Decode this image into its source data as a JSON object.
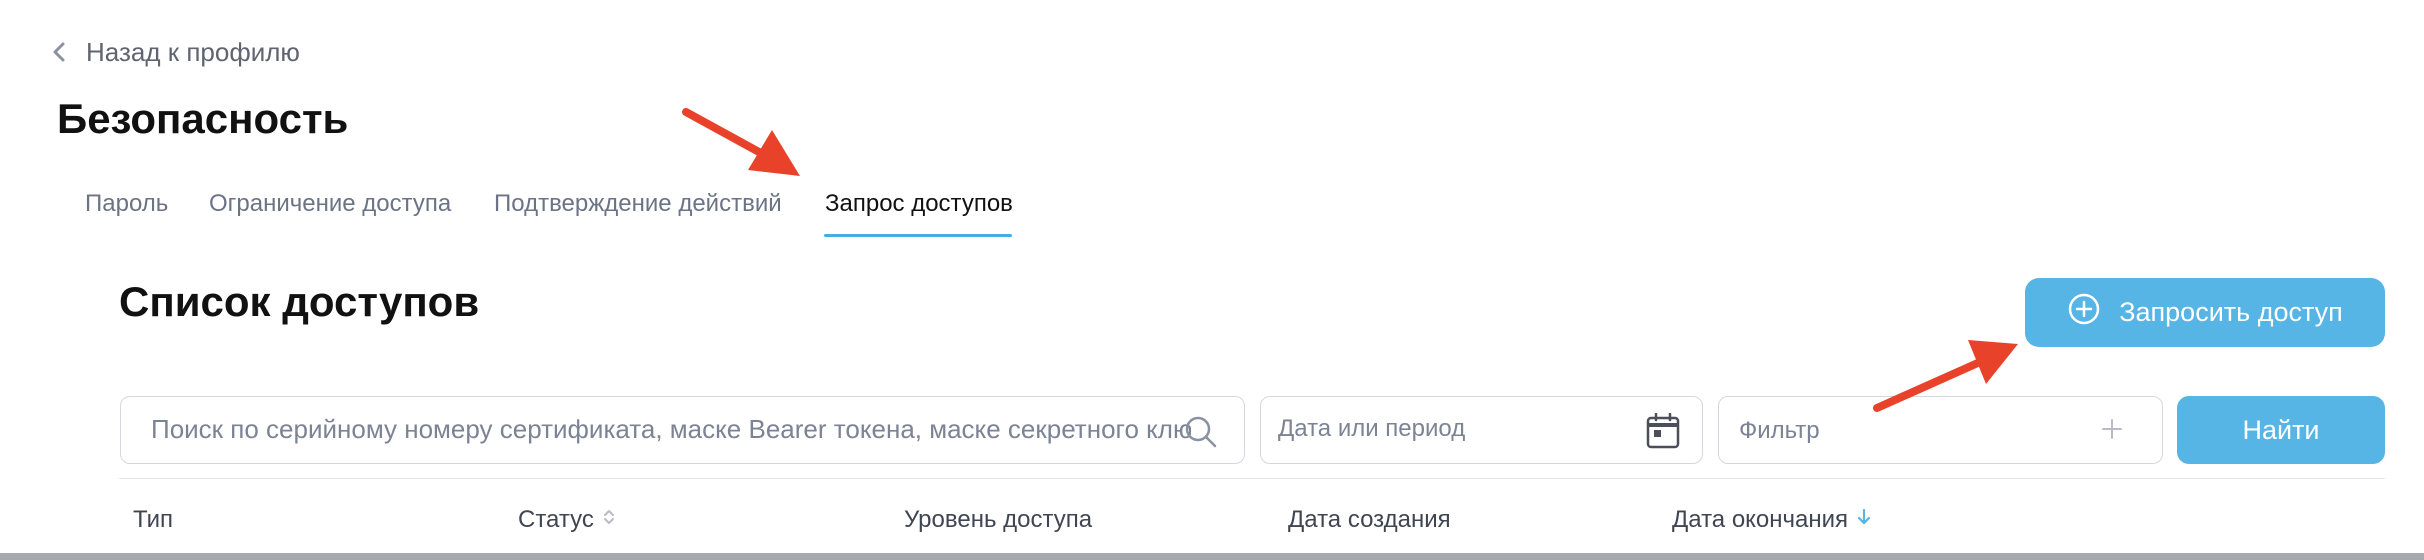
{
  "back_link": {
    "label": "Назад к профилю",
    "icon": "chevron-left-icon"
  },
  "page_title": "Безопасность",
  "tabs": [
    {
      "label": "Пароль",
      "active": false
    },
    {
      "label": "Ограничение доступа",
      "active": false
    },
    {
      "label": "Подтверждение действий",
      "active": false
    },
    {
      "label": "Запрос доступов",
      "active": true
    }
  ],
  "section_title": "Список доступов",
  "request_button": {
    "label": "Запросить доступ",
    "icon": "plus-circle-icon"
  },
  "filters": {
    "search_placeholder": "Поиск по серийному номеру сертификата, маске Bearer токена, маске секретного ключа",
    "date_placeholder": "Дата или период",
    "filter_label": "Фильтр",
    "find_label": "Найти"
  },
  "table": {
    "columns": [
      {
        "label": "Тип",
        "sort": "none"
      },
      {
        "label": "Статус",
        "sort": "both"
      },
      {
        "label": "Уровень доступа",
        "sort": "none"
      },
      {
        "label": "Дата создания",
        "sort": "none"
      },
      {
        "label": "Дата окончания",
        "sort": "desc"
      }
    ]
  },
  "colors": {
    "accent": "#56b5e4",
    "tab_underline": "#45aee0",
    "annotation_arrow": "#e8432a",
    "muted_text": "#6b7385"
  }
}
